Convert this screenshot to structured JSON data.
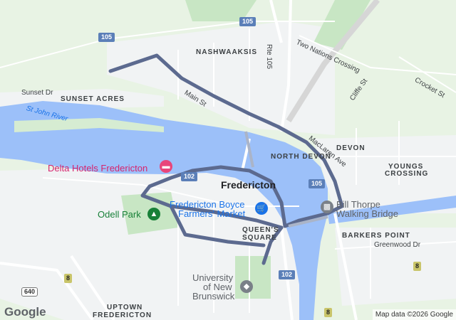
{
  "map": {
    "areas": {
      "nashwaaksis": "NASHWAAKSIS",
      "sunset_acres": "SUNSET ACRES",
      "north_devon": "NORTH DEVON",
      "devon": "DEVON",
      "youngs_crossing_1": "YOUNGS",
      "youngs_crossing_2": "CROSSING",
      "queens_square_1": "QUEEN'S",
      "queens_square_2": "SQUARE",
      "barkers_point": "BARKERS POINT",
      "uptown_fredericton_1": "UPTOWN",
      "uptown_fredericton_2": "FREDERICTON",
      "city": "Fredericton"
    },
    "roads": {
      "sunset_dr": "Sunset Dr",
      "main_st": "Main St",
      "rte_105": "Rte 105",
      "two_nations": "Two Nations Crossing",
      "cliffe_st": "Cliffe St",
      "crocket_st": "Crocket St",
      "maclaren_ave": "MacLaren Ave",
      "greenwood_dr": "Greenwood Dr"
    },
    "water": {
      "st_john_river": "St John River"
    },
    "pois": {
      "delta": "Delta Hotels Fredericton",
      "farmers_market_1": "Fredericton Boyce",
      "farmers_market_2": "Farmers' Market",
      "odell_park": "Odell Park",
      "bill_thorpe_1": "Bill Thorpe",
      "bill_thorpe_2": "Walking Bridge",
      "unb_1": "University",
      "unb_2": "of New",
      "unb_3": "Brunswick"
    },
    "shields": {
      "s105_top": "105",
      "s105_right": "105",
      "s102_left": "102",
      "s102_bottom": "102",
      "s8_left": "8",
      "s8_right": "8",
      "s8_bottom": "8",
      "s640": "640"
    },
    "colors": {
      "water": "#9cc0f9",
      "land": "#e8f3e4",
      "urban": "#f1f3f4",
      "route_highlight": "#5c6a8f",
      "hotel_pin": "#e8457a",
      "market_pin": "#1a73e8",
      "park_pin": "#188038",
      "bridge_pin": "#7a8088",
      "unb_pin": "#7a8088"
    },
    "icons": {
      "hotel": "bed-icon",
      "market": "shopping-cart-icon",
      "park": "tree-icon",
      "bridge": "bridge-icon",
      "university": "graduation-cap-icon"
    }
  },
  "footer": {
    "logo": "Google",
    "attribution": "Map data ©2026 Google"
  }
}
